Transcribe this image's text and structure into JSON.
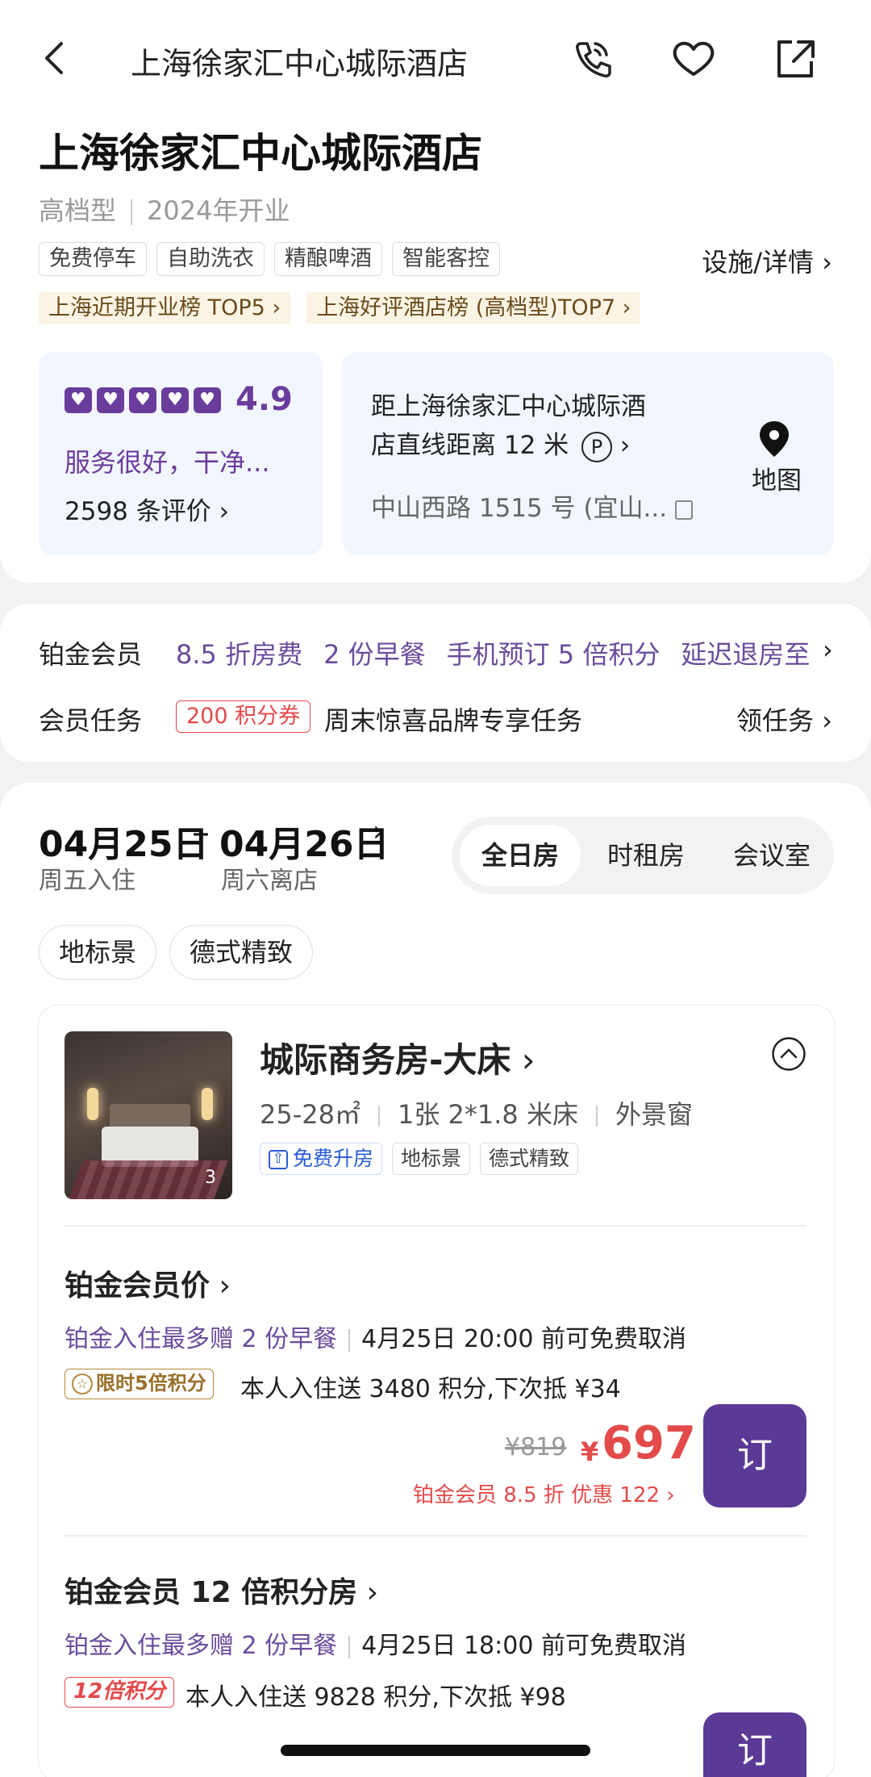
{
  "nav": {
    "title": "上海徐家汇中心城际酒店",
    "back_icon": "back-arrow-icon",
    "phone_icon": "phone-icon",
    "favorite_icon": "heart-icon",
    "share_icon": "share-icon"
  },
  "hotel": {
    "name": "上海徐家汇中心城际酒店",
    "grade": "高档型",
    "opened": "2024年开业",
    "tags": [
      "免费停车",
      "自助洗衣",
      "精酿啤酒",
      "智能客控"
    ],
    "facility_link": "设施/详情",
    "rankings": [
      "上海近期开业榜 TOP5",
      "上海好评酒店榜 (高档型)TOP7"
    ]
  },
  "rating": {
    "score": "4.9",
    "hearts": 5,
    "summary": "服务很好，干净...",
    "review_count": "2598 条评价"
  },
  "location": {
    "distance_line1": "距上海徐家汇中心城际酒",
    "distance_line2": "店直线距离 12 米",
    "parking_symbol": "P",
    "address": "中山西路 1515 号 (宜山...",
    "map_label": "地图"
  },
  "member": {
    "level_label": "铂金会员",
    "benefits": [
      "8.5 折房费",
      "2 份早餐",
      "手机预订 5 倍积分",
      "延迟退房至"
    ],
    "task_label": "会员任务",
    "coupon": "200 积分券",
    "task_text": "周末惊喜品牌专享任务",
    "task_link": "领任务"
  },
  "booking": {
    "checkin_date": "04月25日",
    "checkin_day": "周五入住",
    "dash": "–",
    "checkout_date": "04月26日",
    "checkout_day": "周六离店",
    "room_types": [
      "全日房",
      "时租房",
      "会议室"
    ],
    "active_type": "全日房",
    "filters": [
      "地标景",
      "德式精致"
    ]
  },
  "room": {
    "name": "城际商务房-大床",
    "photo_count": "3",
    "area": "25-28㎡",
    "bed": "1张 2*1.8 米床",
    "window": "外景窗",
    "tags": [
      "免费升房",
      "地标景",
      "德式精致"
    ]
  },
  "rates": [
    {
      "title": "铂金会员价",
      "breakfast": "铂金入住最多赠 2 份早餐",
      "cancel": "4月25日 20:00 前可免费取消",
      "badge": "限时5倍积分",
      "points": "本人入住送 3480 积分,下次抵 ¥34",
      "old_price": "¥819",
      "currency": "¥",
      "price": "697",
      "discount": "铂金会员 8.5 折 优惠 122",
      "book_label": "订"
    },
    {
      "title": "铂金会员 12 倍积分房",
      "breakfast": "铂金入住最多赠 2 份早餐",
      "cancel": "4月25日 18:00 前可免费取消",
      "badge": "12倍积分",
      "points": "本人入住送 9828 积分,下次抵 ¥98",
      "book_label": "订"
    }
  ],
  "colors": {
    "brand_purple": "#5b3a96",
    "member_purple": "#6a4c9c",
    "price_red": "#e34a4a",
    "rank_bg": "#fbf4e4"
  }
}
